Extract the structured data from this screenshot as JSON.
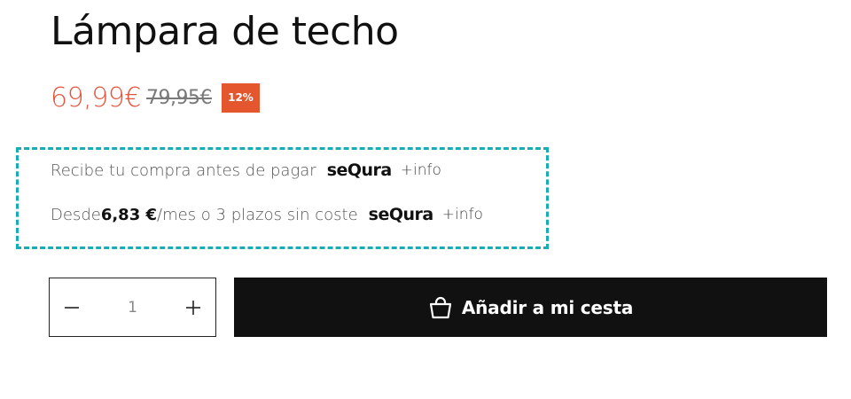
{
  "product": {
    "title": "Lámpara de techo",
    "price_current": "69,99€",
    "price_old": "79,95€",
    "discount": "12%"
  },
  "colors": {
    "accent_price": "#e5553d",
    "discount_bg": "#e4572e",
    "dashed_border": "#18adb5",
    "button_bg": "#111111"
  },
  "financing": {
    "line1": {
      "text": "Recibe tu compra antes de pagar",
      "brand": "seQura",
      "info": "+info"
    },
    "line2": {
      "prefix": "Desde ",
      "amount": "6,83 €",
      "suffix": "/mes o 3 plazos sin coste",
      "brand": "seQura",
      "info": "+info"
    }
  },
  "quantity": {
    "value": "1",
    "minus_icon": "minus-icon",
    "plus_icon": "plus-icon"
  },
  "cart_button": {
    "label": "Añadir a mi cesta",
    "icon": "shopping-bag-icon"
  }
}
